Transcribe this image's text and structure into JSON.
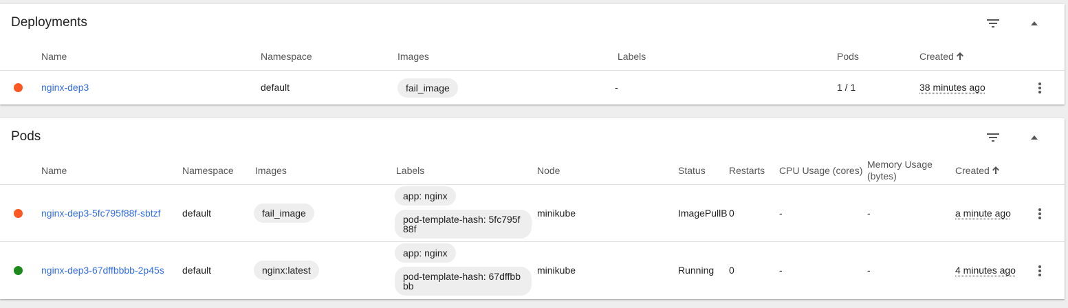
{
  "deployments": {
    "title": "Deployments",
    "columns": {
      "name": "Name",
      "namespace": "Namespace",
      "images": "Images",
      "labels": "Labels",
      "pods": "Pods",
      "created": "Created"
    },
    "rows": [
      {
        "status_color": "#ff5722",
        "name": "nginx-dep3",
        "namespace": "default",
        "image": "fail_image",
        "labels": "-",
        "pods": "1 / 1",
        "created": "38 minutes ago"
      }
    ]
  },
  "pods": {
    "title": "Pods",
    "columns": {
      "name": "Name",
      "namespace": "Namespace",
      "images": "Images",
      "labels": "Labels",
      "node": "Node",
      "status": "Status",
      "restarts": "Restarts",
      "cpu": "CPU Usage (cores)",
      "memory_line1": "Memory Usage",
      "memory_line2": "(bytes)",
      "created": "Created"
    },
    "rows": [
      {
        "status_color": "#ff5722",
        "name": "nginx-dep3-5fc795f88f-sbtzf",
        "namespace": "default",
        "image": "fail_image",
        "label_app": "app: nginx",
        "label_hash": "pod-template-hash: 5fc795f88f",
        "node": "minikube",
        "status": "ImagePullB",
        "restarts": "0",
        "cpu": "-",
        "memory": "-",
        "created": "a minute ago"
      },
      {
        "status_color": "#1b8a1b",
        "name": "nginx-dep3-67dffbbbb-2p45s",
        "namespace": "default",
        "image": "nginx:latest",
        "label_app": "app: nginx",
        "label_hash": "pod-template-hash: 67dffbbbb",
        "node": "minikube",
        "status": "Running",
        "restarts": "0",
        "cpu": "-",
        "memory": "-",
        "created": "4 minutes ago"
      }
    ]
  },
  "icons": {
    "filter": "filter-icon",
    "collapse": "expand-less-icon",
    "more": "more-vert-icon",
    "sort": "arrow-upward-icon"
  }
}
